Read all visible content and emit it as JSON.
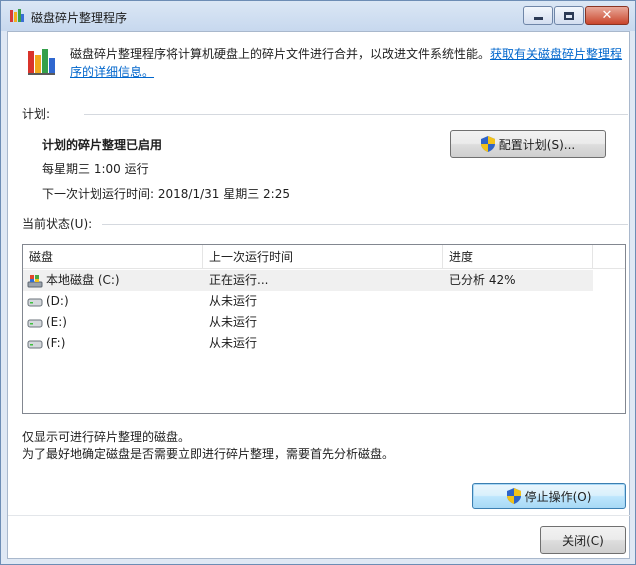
{
  "window": {
    "title": "磁盘碎片整理程序",
    "close_glyph": "✕"
  },
  "intro": {
    "text": "磁盘碎片整理程序将计算机硬盘上的碎片文件进行合并，以改进文件系统性能。",
    "link": "获取有关磁盘碎片整理程序的详细信息。"
  },
  "schedule": {
    "section_label": "计划:",
    "status": "计划的碎片整理已启用",
    "frequency": "每星期三  1:00 运行",
    "next_run": "下一次计划运行时间: 2018/1/31 星期三 2:25",
    "configure_button": "配置计划(S)..."
  },
  "current_status": {
    "section_label": "当前状态(U):",
    "columns": [
      "磁盘",
      "上一次运行时间",
      "进度"
    ],
    "rows": [
      {
        "disk": "本地磁盘 (C:)",
        "last_run": "正在运行...",
        "progress": "已分析 42%",
        "icon": "system-drive-icon"
      },
      {
        "disk": "(D:)",
        "last_run": "从未运行",
        "progress": "",
        "icon": "drive-icon"
      },
      {
        "disk": "(E:)",
        "last_run": "从未运行",
        "progress": "",
        "icon": "drive-icon"
      },
      {
        "disk": "(F:)",
        "last_run": "从未运行",
        "progress": "",
        "icon": "drive-icon"
      }
    ]
  },
  "notes": {
    "line1": "仅显示可进行碎片整理的磁盘。",
    "line2": "为了最好地确定磁盘是否需要立即进行碎片整理，需要首先分析磁盘。"
  },
  "buttons": {
    "stop": "停止操作(O)",
    "close": "关闭(C)"
  },
  "colors": {
    "link": "#0066cc",
    "titlebar": "#c7d8ee"
  }
}
